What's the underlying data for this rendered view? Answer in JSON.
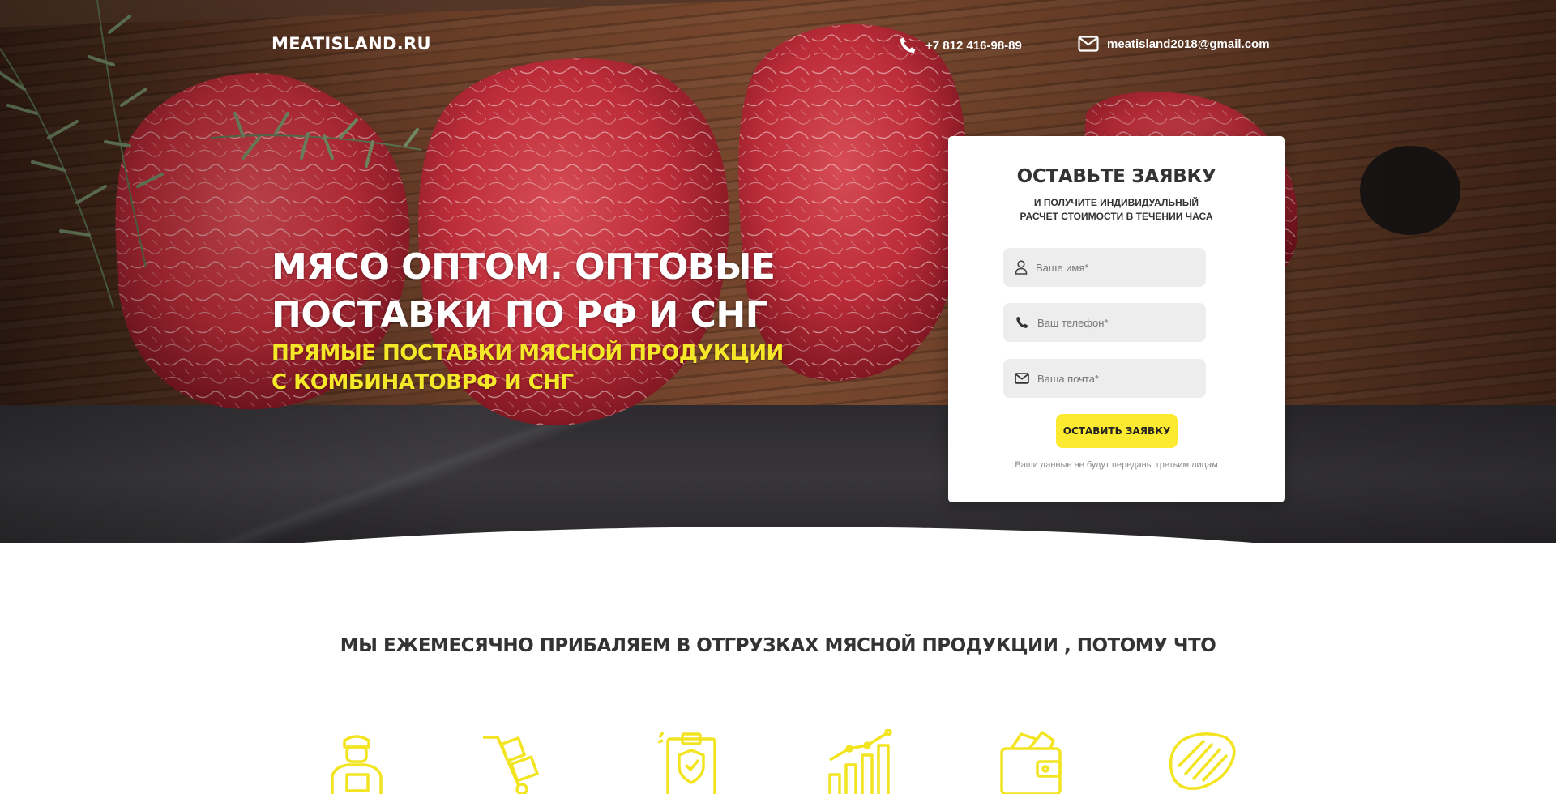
{
  "header": {
    "logo": "MEATISLAND.RU",
    "phone": "+7 812 416-98-89",
    "email": "meatisland2018@gmail.com"
  },
  "hero": {
    "title_line1": "МЯСО ОПТОМ. ОПТОВЫЕ",
    "title_line2": "ПОСТАВКИ ПО РФ И СНГ",
    "subtitle_line1": "ПРЯМЫЕ ПОСТАВКИ МЯСНОЙ ПРОДУКЦИИ",
    "subtitle_line2": "С КОМБИНАТОВРФ И СНГ"
  },
  "form": {
    "title": "ОСТАВЬТЕ ЗАЯВКУ",
    "subtitle_line1": "И ПОЛУЧИТЕ ИНДИВИДУАЛЬНЫЙ",
    "subtitle_line2": "РАСЧЕТ СТОИМОСТИ В ТЕЧЕНИИ ЧАСА",
    "name_placeholder": "Ваше имя*",
    "phone_placeholder": "Ваш телефон*",
    "email_placeholder": "Ваша почта*",
    "submit_label": "ОСТАВИТЬ ЗАЯВКУ",
    "privacy_note": "Ваши данные не будут переданы третьим лицам"
  },
  "benefits": {
    "title": "МЫ ЕЖЕМЕСЯЧНО ПРИБАЛЯЕМ В ОТГРУЗКАХ МЯСНОЙ ПРОДУКЦИИ , ПОТОМУ ЧТО",
    "icons": [
      "courier-icon",
      "hand-truck-icon",
      "quality-clipboard-icon",
      "growth-chart-icon",
      "wallet-icon",
      "meat-steak-icon"
    ]
  },
  "colors": {
    "accent_yellow": "#fbea2f",
    "title_yellow": "#f5e829",
    "icon_yellow": "#f2e420",
    "text_dark": "#333333",
    "field_bg": "#ededed"
  }
}
